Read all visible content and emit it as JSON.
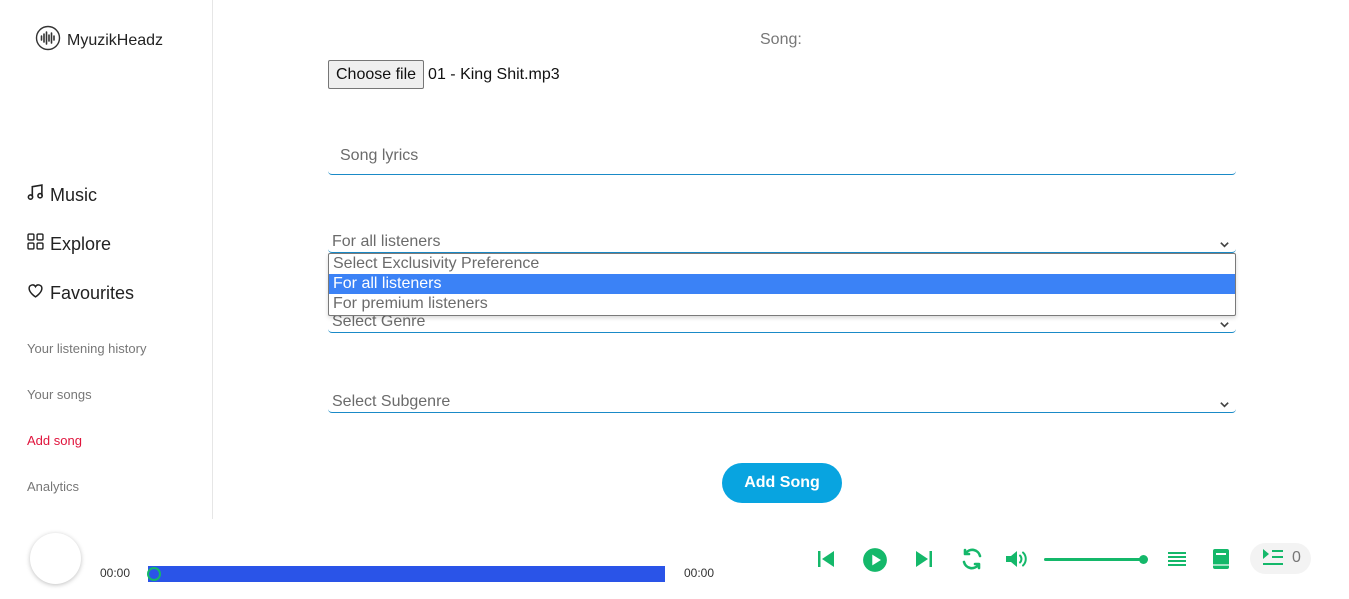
{
  "brand": {
    "name": "MyuzikHeadz",
    "icon": "waveform-logo-icon"
  },
  "sidebar": {
    "main_items": [
      {
        "label": "Music",
        "icon": "music-note-icon"
      },
      {
        "label": "Explore",
        "icon": "grid-icon"
      },
      {
        "label": "Favourites",
        "icon": "heart-icon"
      }
    ],
    "sub_items": [
      {
        "label": "Your listening history"
      },
      {
        "label": "Your songs"
      },
      {
        "label": "Add song",
        "active": true
      },
      {
        "label": "Analytics"
      }
    ]
  },
  "form": {
    "song_label": "Song:",
    "choose_file_label": "Choose file",
    "file_name": "01 - King Shit.mp3",
    "lyrics_placeholder": "Song lyrics",
    "exclusivity_value": "For all listeners",
    "exclusivity_options": [
      "Select Exclusivity Preference",
      "For all listeners",
      "For premium listeners"
    ],
    "exclusivity_selected_index": 1,
    "genre_placeholder": "Select Genre",
    "subgenre_placeholder": "Select Subgenre",
    "submit_label": "Add Song"
  },
  "player": {
    "current_time": "00:00",
    "duration": "00:00",
    "progress": 0,
    "volume": 1.0,
    "queue_count": "0",
    "accent_color": "#14b86a",
    "progress_color": "#2a54e8"
  },
  "colors": {
    "active_nav": "#e0143c",
    "button": "#08a4e0",
    "underline": "#1a8ac7",
    "selected_option": "#3b82f6"
  }
}
